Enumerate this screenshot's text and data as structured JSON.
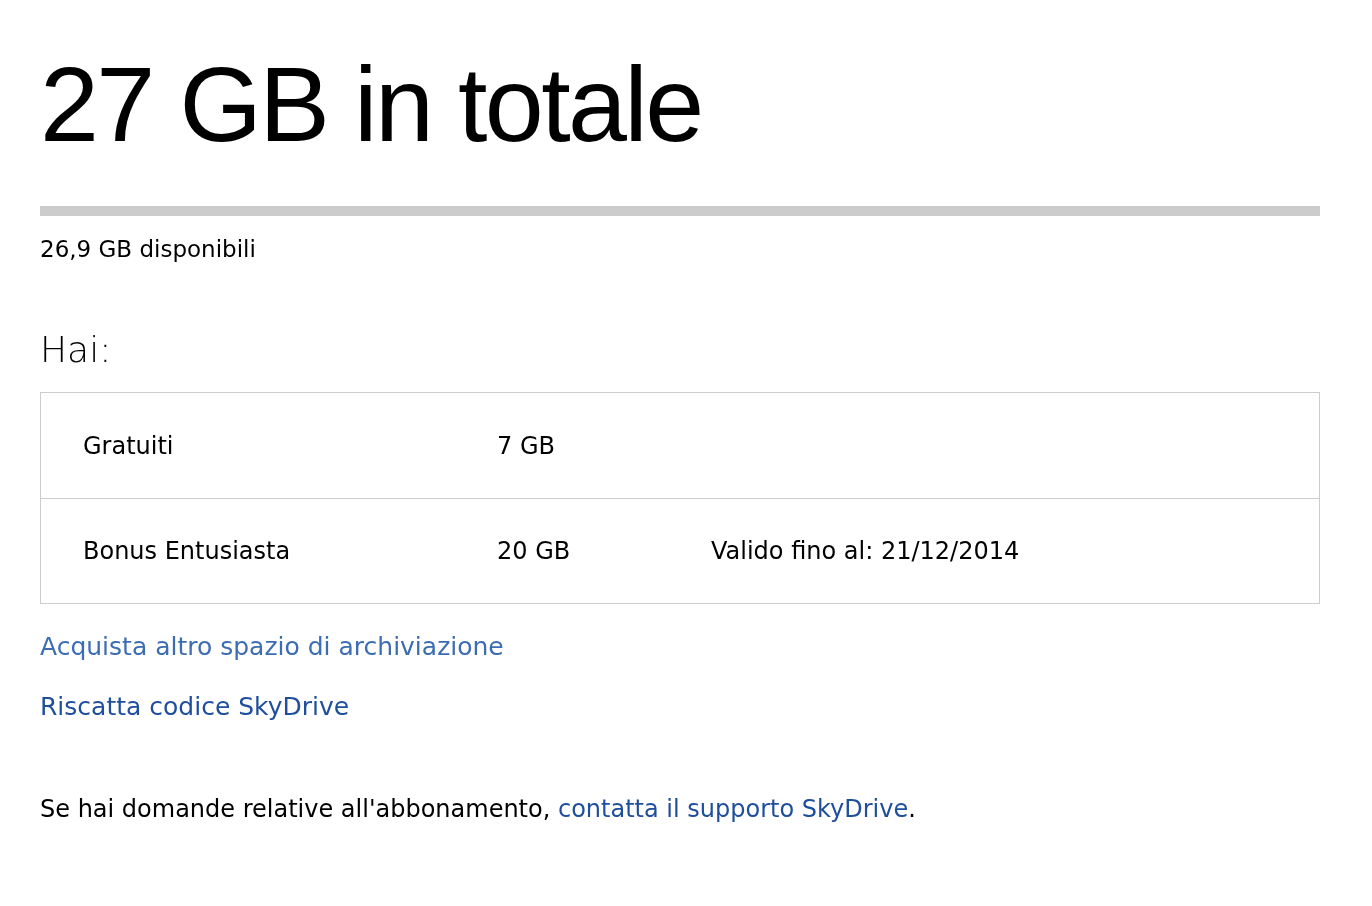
{
  "heading": "27 GB in totale",
  "available": "26,9 GB disponibili",
  "plans_heading": "Hai:",
  "plans": [
    {
      "name": "Gratuiti",
      "size": "7 GB"
    },
    {
      "name": "Bonus Entusiasta",
      "size": "20 GB",
      "validity": "Valido fino al: 21/12/2014"
    }
  ],
  "links": [
    "Acquista altro spazio di archiviazione",
    "Riscatta codice SkyDrive"
  ],
  "support_note": {
    "text": "Se hai domande relative all'abbonamento, ",
    "link": "contatta il supporto SkyDrive",
    "end": "."
  }
}
